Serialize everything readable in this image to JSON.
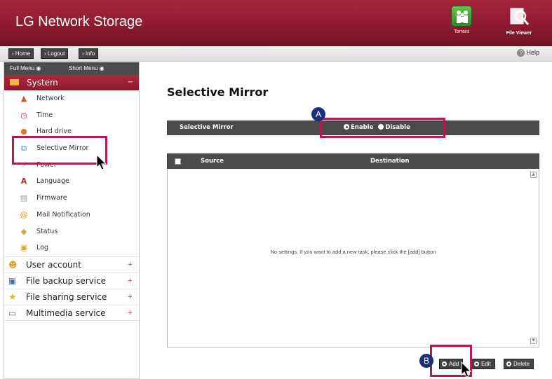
{
  "header": {
    "app_title": "LG Network Storage",
    "apps": [
      {
        "label": "Torrent",
        "icon": "torrent-icon"
      },
      {
        "label": "File Viewer",
        "icon": "file-viewer-icon"
      }
    ]
  },
  "topnav": {
    "home": "Home",
    "logout": "Logout",
    "info": "Info",
    "help": "Help"
  },
  "sidebar": {
    "full_menu": "Full Menu",
    "short_menu": "Short Menu",
    "system_label": "System",
    "system_items": [
      {
        "label": "Network",
        "icon": "network-icon"
      },
      {
        "label": "Time",
        "icon": "clock-icon"
      },
      {
        "label": "Hard drive",
        "icon": "hard-drive-icon"
      },
      {
        "label": "Selective Mirror",
        "icon": "mirror-icon"
      },
      {
        "label": "Power",
        "icon": "power-icon"
      },
      {
        "label": "Language",
        "icon": "language-icon"
      },
      {
        "label": "Firmware",
        "icon": "firmware-icon"
      },
      {
        "label": "Mail Notification",
        "icon": "mail-icon"
      },
      {
        "label": "Status",
        "icon": "status-icon"
      },
      {
        "label": "Log",
        "icon": "log-icon"
      }
    ],
    "categories": [
      {
        "label": "User account",
        "icon": "user-account-icon"
      },
      {
        "label": "File backup service",
        "icon": "backup-icon"
      },
      {
        "label": "File sharing service",
        "icon": "star-icon"
      },
      {
        "label": "Multimedia service",
        "icon": "multimedia-icon"
      }
    ]
  },
  "main": {
    "page_title": "Selective Mirror",
    "setting_label": "Selective Mirror",
    "enable_label": "Enable",
    "disable_label": "Disable",
    "selected": "Enable",
    "table": {
      "col_source": "Source",
      "col_destination": "Destination",
      "empty_message": "No settings. If you want to add a new task, please click the [add] button"
    },
    "buttons": {
      "add": "Add",
      "edit": "Edit",
      "delete": "Delete"
    }
  },
  "annotations": {
    "a": "A",
    "b": "B"
  },
  "colors": {
    "brand": "#8c1b2e",
    "highlight": "#b01c4b",
    "badge": "#1b2f7a",
    "bar": "#4a4a4a"
  }
}
